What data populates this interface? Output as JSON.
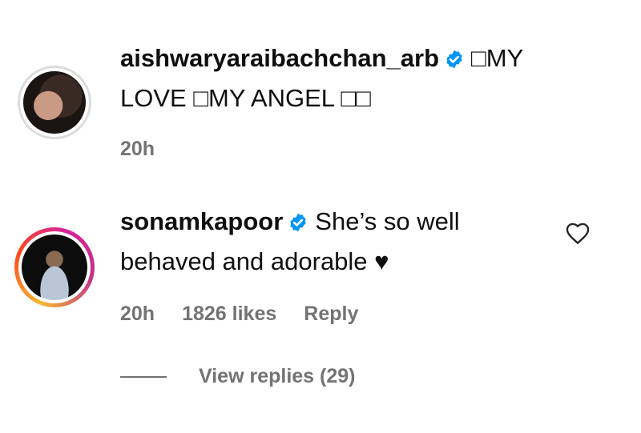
{
  "comments": [
    {
      "username": "aishwaryaraibachchan_arb",
      "text": "□MY LOVE □MY ANGEL □□",
      "time": "20h"
    },
    {
      "username": "sonamkapoor",
      "text": "She’s so well behaved and adorable ♥",
      "time": "20h",
      "likes": "1826 likes",
      "reply_label": "Reply",
      "view_replies": "View replies (29)"
    }
  ],
  "colors": {
    "verified": "#0095f6",
    "meta_text": "#737373",
    "story_ring": "#d6249f"
  },
  "icons": {
    "verified": "verified-badge-icon",
    "like": "heart-outline-icon"
  }
}
